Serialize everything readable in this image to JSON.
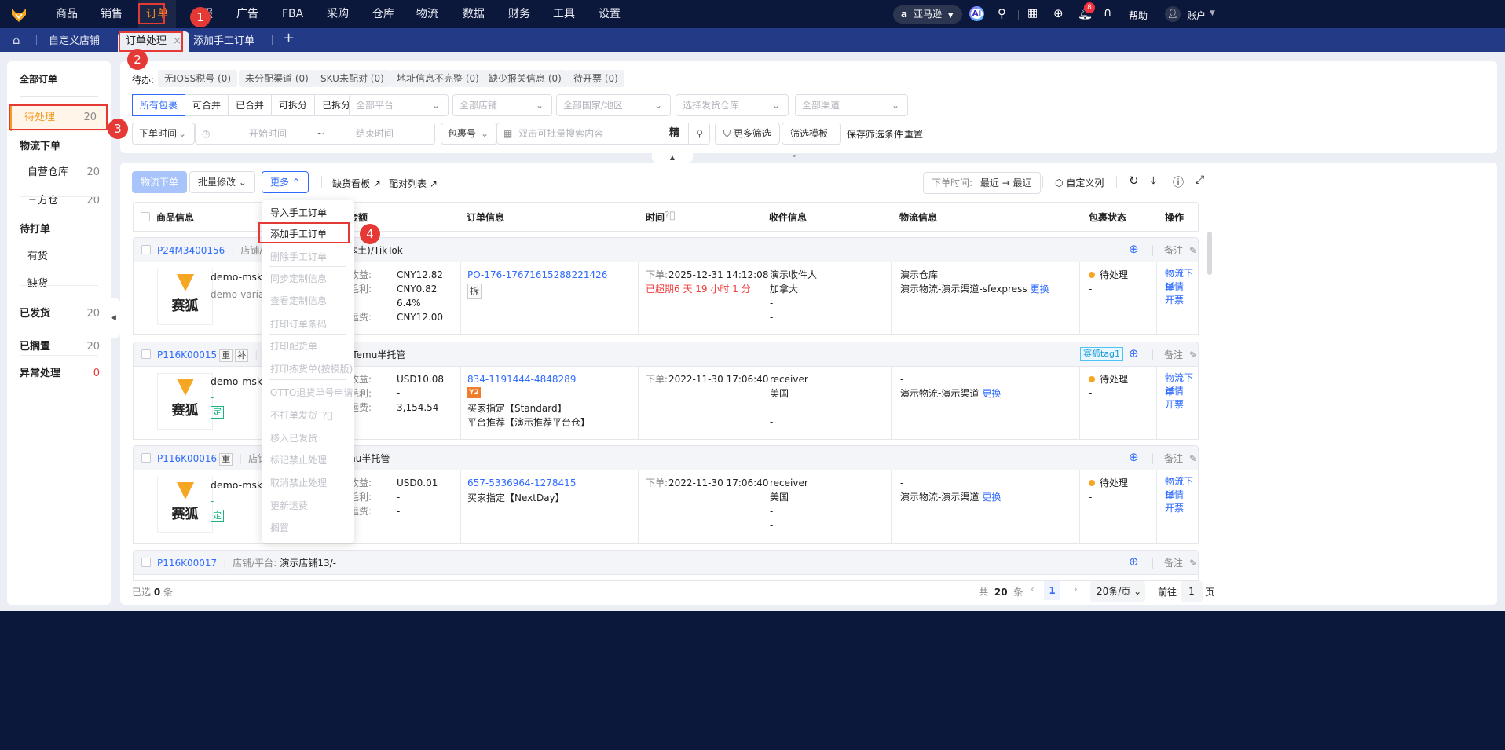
{
  "topnav": {
    "items": [
      "商品",
      "销售",
      "订单",
      "客服",
      "广告",
      "FBA",
      "采购",
      "仓库",
      "物流",
      "数据",
      "财务",
      "工具",
      "设置"
    ],
    "active_index": 2,
    "platform": "亚马逊",
    "ai": "AI",
    "notification_count": "8",
    "help": "帮助",
    "account": "账户"
  },
  "tabs": {
    "items": [
      "自定义店铺",
      "订单处理",
      "添加手工订单"
    ],
    "active_index": 1
  },
  "sidebar": {
    "all_orders": "全部订单",
    "items": [
      {
        "label": "待处理",
        "count": "20",
        "active": true
      },
      {
        "label": "物流下单",
        "count": ""
      },
      {
        "label": "自营仓库",
        "count": "20",
        "sub": true
      },
      {
        "label": "三方仓",
        "count": "20",
        "sub": true
      },
      {
        "label": "待打单",
        "count": ""
      },
      {
        "label": "有货",
        "count": "",
        "sub": true
      },
      {
        "label": "缺货",
        "count": "",
        "sub": true
      },
      {
        "label": "已发货",
        "count": "20"
      },
      {
        "label": "已搁置",
        "count": "20"
      },
      {
        "label": "异常处理",
        "count": "0",
        "red": true
      }
    ]
  },
  "filters": {
    "todo_label": "待办:",
    "todo_chips": [
      "无IOSS税号 (0)",
      "未分配渠道 (0)",
      "SKU未配对 (0)",
      "地址信息不完整 (0)",
      "缺少报关信息 (0)",
      "待开票 (0)"
    ],
    "package_tabs": [
      "所有包裹",
      "可合并",
      "已合并",
      "可拆分",
      "已拆分"
    ],
    "selects": [
      "全部平台",
      "全部店铺",
      "全部国家/地区",
      "选择发货仓库",
      "全部渠道"
    ],
    "time_type": "下单时间",
    "start_placeholder": "开始时间",
    "range_sep": "~",
    "end_placeholder": "结束时间",
    "search_type": "包裹号",
    "search_placeholder": "双击可批量搜索内容",
    "precise": "精",
    "more_filters": "更多筛选",
    "filter_template": "筛选模板",
    "save_filter": "保存筛选条件",
    "reset": "重置"
  },
  "toolbar": {
    "ship": "物流下单",
    "batch_edit": "批量修改",
    "more": "更多",
    "stockout_board": "缺货看板",
    "pair_list": "配对列表",
    "sort_label": "下单时间:",
    "sort_value": "最近 → 最远",
    "custom_columns": "自定义列"
  },
  "more_menu": [
    {
      "label": "导入手工订单",
      "disabled": false
    },
    {
      "label": "添加手工订单",
      "disabled": false
    },
    {
      "label": "删除手工订单",
      "disabled": true
    },
    {
      "label": "同步定制信息",
      "disabled": true
    },
    {
      "label": "查看定制信息",
      "disabled": true
    },
    {
      "label": "打印订单条码",
      "disabled": true
    },
    {
      "label": "打印配货单",
      "disabled": true
    },
    {
      "label": "打印拣货单(按模版)",
      "disabled": true
    },
    {
      "label": "OTTO退货单号申请",
      "disabled": true
    },
    {
      "label": "不打单发货",
      "disabled": true
    },
    {
      "label": "移入已发货",
      "disabled": true
    },
    {
      "label": "标记禁止处理",
      "disabled": true
    },
    {
      "label": "取消禁止处理",
      "disabled": true
    },
    {
      "label": "更新运费",
      "disabled": true
    },
    {
      "label": "搁置",
      "disabled": true
    }
  ],
  "table": {
    "headers": [
      "商品信息",
      "订单金额",
      "订单信息",
      "时间",
      "收件信息",
      "物流信息",
      "包裹状态",
      "操作"
    ],
    "shop_label": "店铺/平台:",
    "note": "备注",
    "change": "更换",
    "ops": [
      "物流下单",
      "详情",
      "开票"
    ],
    "rows": [
      {
        "id": "P24M3400156",
        "tags": [],
        "shop": "演示店铺(中国本土)/TikTok",
        "sku": "demo-msku",
        "variant": "demo-variation",
        "fixed": false,
        "amount": [
          [
            "销售收益:",
            "CNY12.82"
          ],
          [
            "预估毛利:",
            "CNY0.82"
          ],
          [
            "",
            "6.4%"
          ],
          [
            "预估运费:",
            "CNY12.00"
          ]
        ],
        "order_no": "PO-176-17671615288221426",
        "order_tags": [
          "拆"
        ],
        "order_lines": [],
        "time_label": "下单:",
        "time": "2025-12-31 14:12:08",
        "overdue": "已超期6 天 19 小时 1 分",
        "receiver": [
          "演示收件人",
          "加拿大",
          "-",
          "-"
        ],
        "logistics": [
          "演示仓库",
          "演示物流-演示渠道-sfexpress"
        ],
        "status": "待处理",
        "status_sub": "-",
        "shop_tag": ""
      },
      {
        "id": "P116K00015",
        "tags": [
          "重",
          "补"
        ],
        "shop": "演示店铺/Temu半托管",
        "sku": "demo-msku",
        "variant": "-",
        "fixed": true,
        "amount": [
          [
            "销售收益:",
            "USD10.08"
          ],
          [
            "预估毛利:",
            "-"
          ],
          [
            "预估运费:",
            "3,154.54"
          ]
        ],
        "order_no": "834-1191444-4848289",
        "order_tags": [],
        "order_badge": "Y2",
        "order_lines": [
          "买家指定【Standard】",
          "平台推荐【演示推荐平台仓】"
        ],
        "time_label": "下单:",
        "time": "2022-11-30 17:06:40",
        "overdue": "",
        "receiver": [
          "receiver",
          "美国",
          "-",
          "-"
        ],
        "logistics": [
          "-",
          "演示物流-演示渠道"
        ],
        "status": "待处理",
        "status_sub": "-",
        "shop_tag": "赛狐tag1"
      },
      {
        "id": "P116K00016",
        "tags": [
          "重"
        ],
        "shop": "演示店铺/Temu半托管",
        "sku": "demo-msku",
        "variant": "-",
        "fixed": true,
        "amount": [
          [
            "销售收益:",
            "USD0.01"
          ],
          [
            "预估毛利:",
            "-"
          ],
          [
            "预估运费:",
            "-"
          ]
        ],
        "order_no": "657-5336964-1278415",
        "order_tags": [],
        "order_lines": [
          "买家指定【NextDay】"
        ],
        "time_label": "下单:",
        "time": "2022-11-30 17:06:40",
        "overdue": "",
        "receiver": [
          "receiver",
          "美国",
          "-",
          "-"
        ],
        "logistics": [
          "-",
          "演示物流-演示渠道"
        ],
        "status": "待处理",
        "status_sub": "-",
        "shop_tag": ""
      },
      {
        "id": "P116K00017",
        "tags": [],
        "shop": "演示店铺13/-"
      }
    ],
    "logo_text": "赛狐",
    "fixed_tag": "定"
  },
  "footer": {
    "selected_prefix": "已选",
    "selected": "0",
    "selected_suffix": "条",
    "total_prefix": "共",
    "total": "20",
    "total_suffix": "条",
    "page": "1",
    "page_size": "20条/页",
    "goto": "前往",
    "goto_value": "1",
    "page_suffix": "页"
  },
  "annotations": [
    "1",
    "2",
    "3",
    "4"
  ],
  "colors": {
    "accent": "#2f6bff",
    "brand_orange": "#f5a623",
    "danger": "#e53935",
    "nav_bg": "#0c183b",
    "tab_bg": "#233a86"
  }
}
